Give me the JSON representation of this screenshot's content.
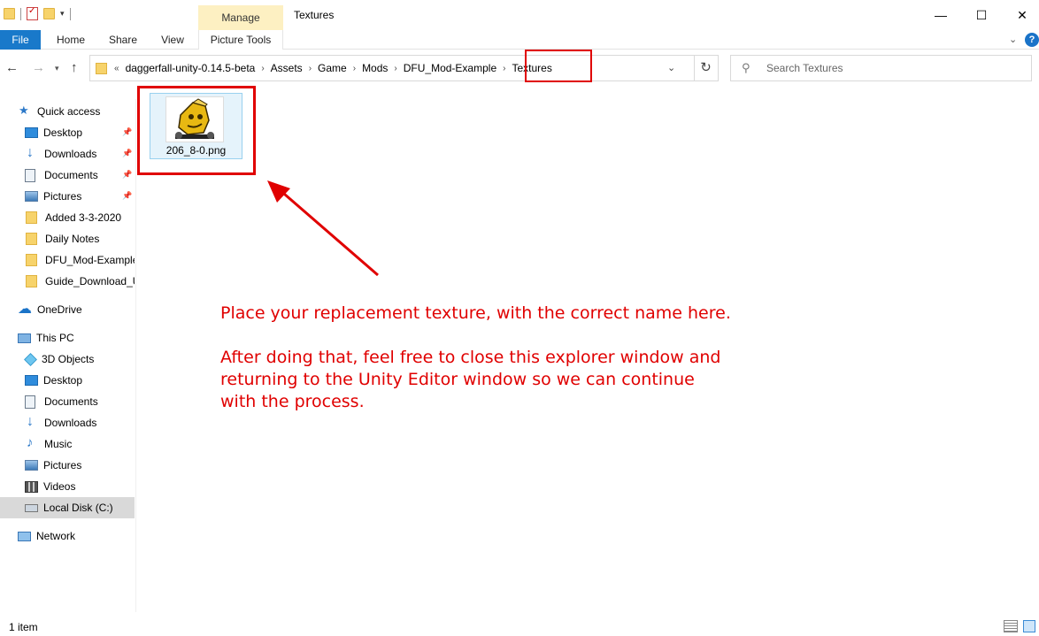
{
  "window": {
    "title": "Textures",
    "context_tab": "Manage",
    "controls": {
      "minimize": "—",
      "maximize": "☐",
      "close": "✕"
    }
  },
  "ribbon": {
    "tabs": [
      {
        "label": "File"
      },
      {
        "label": "Home"
      },
      {
        "label": "Share"
      },
      {
        "label": "View"
      },
      {
        "label": "Picture Tools"
      }
    ],
    "help": "?"
  },
  "address": {
    "overflow": "«",
    "crumbs": [
      "daggerfall-unity-0.14.5-beta",
      "Assets",
      "Game",
      "Mods",
      "DFU_Mod-Example",
      "Textures"
    ],
    "separator": "›"
  },
  "search": {
    "placeholder": "Search Textures"
  },
  "sidebar": {
    "quick_access": "Quick access",
    "quick_items": [
      {
        "label": "Desktop",
        "icon": "desktop-icon",
        "pinned": true
      },
      {
        "label": "Downloads",
        "icon": "downloads-icon",
        "pinned": true
      },
      {
        "label": "Documents",
        "icon": "documents-icon",
        "pinned": true
      },
      {
        "label": "Pictures",
        "icon": "pictures-icon",
        "pinned": true
      },
      {
        "label": "Added 3-3-2020",
        "icon": "folder-icon"
      },
      {
        "label": "Daily Notes",
        "icon": "folder-icon"
      },
      {
        "label": "DFU_Mod-Example",
        "icon": "folder-icon"
      },
      {
        "label": "Guide_Download_U",
        "icon": "folder-icon"
      }
    ],
    "onedrive": "OneDrive",
    "this_pc": "This PC",
    "pc_items": [
      {
        "label": "3D Objects",
        "icon": "3d-objects-icon"
      },
      {
        "label": "Desktop",
        "icon": "desktop-icon"
      },
      {
        "label": "Documents",
        "icon": "documents-icon"
      },
      {
        "label": "Downloads",
        "icon": "downloads-icon"
      },
      {
        "label": "Music",
        "icon": "music-icon"
      },
      {
        "label": "Pictures",
        "icon": "pictures-icon"
      },
      {
        "label": "Videos",
        "icon": "videos-icon"
      },
      {
        "label": "Local Disk (C:)",
        "icon": "disk-icon",
        "selected": true
      }
    ],
    "network": "Network"
  },
  "files": [
    {
      "name": "206_8-0.png"
    }
  ],
  "annotation": {
    "line1": "Place your replacement texture, with the correct name here.",
    "line2": "After doing that, feel free to close this explorer window and",
    "line3": "returning to the Unity Editor window so we can continue",
    "line4": "with the process.",
    "color": "#e00000"
  },
  "status": {
    "item_count": "1 item"
  },
  "colors": {
    "file_tab": "#1979ca",
    "manage_tab": "#fdf0c2",
    "selection": "#e5f3fb",
    "highlight": "#e00000"
  }
}
